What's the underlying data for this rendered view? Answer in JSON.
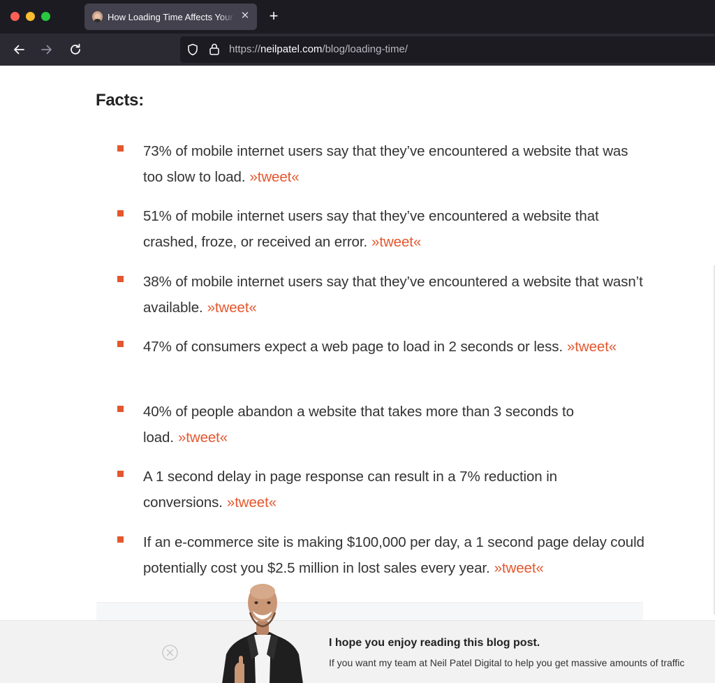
{
  "browser": {
    "tab_title": "How Loading Time Affects Your Bottom Line",
    "tab_close": "✕",
    "new_tab": "+",
    "url_scheme": "https://",
    "url_host": "neilpatel.com",
    "url_path": "/blog/loading-time/",
    "colors": {
      "close": "#ff5f57",
      "minimize": "#febc2e",
      "maximize": "#28c840"
    }
  },
  "article": {
    "heading": "Facts:",
    "bullet_color": "#e4572e",
    "tweet_label": "»tweet«",
    "facts": [
      {
        "text": "73% of mobile internet users say that they’ve encountered a website that was too slow to load."
      },
      {
        "text": "51% of mobile internet users say that they’ve encountered a website that crashed, froze, or received an error."
      },
      {
        "text": "38% of mobile internet users say that they’ve encountered a website that wasn’t available."
      },
      {
        "text": "47% of consumers expect a web page to load in 2 seconds or less."
      },
      {
        "text": "40% of people abandon a website that takes more than 3 seconds to load."
      },
      {
        "text": "A 1 second delay in page response can result in a 7% reduction in conversions."
      },
      {
        "text": "If an e-commerce site is making $100,000 per day, a 1 second page delay could potentially cost you $2.5 million in lost sales every year."
      }
    ]
  },
  "popup": {
    "title": "I hope you enjoy reading this blog post.",
    "body": "If you want my team at Neil Patel Digital to help you get massive amounts of traffic"
  }
}
